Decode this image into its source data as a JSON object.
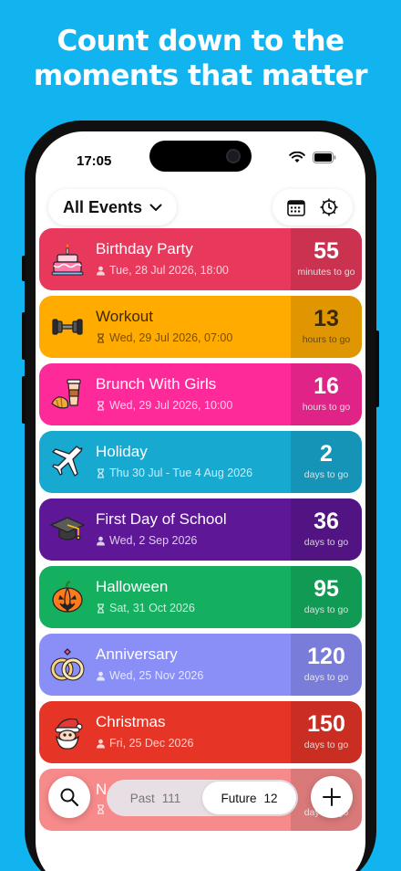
{
  "headline": {
    "line1": "Count down to the",
    "line2": "moments that matter"
  },
  "status_bar": {
    "time": "17:05"
  },
  "topbar": {
    "filter_label": "All Events"
  },
  "events": [
    {
      "title": "Birthday Party",
      "date": "Tue, 28 Jul 2026, 18:00",
      "count": "55",
      "unit": "minutes to go",
      "color": "#e8395c",
      "icon": "cake-icon",
      "person_icon": "person-icon"
    },
    {
      "title": "Workout",
      "date": "Wed, 29 Jul 2026, 07:00",
      "count": "13",
      "unit": "hours to go",
      "color": "#ffab00",
      "icon": "dumbbell-icon",
      "person_icon": "hourglass-icon"
    },
    {
      "title": "Brunch With Girls",
      "date": "Wed, 29 Jul 2026, 10:00",
      "count": "16",
      "unit": "hours to go",
      "color": "#ff2a9a",
      "icon": "coffee-croissant-icon",
      "person_icon": "hourglass-icon"
    },
    {
      "title": "Holiday",
      "date": "Thu 30 Jul - Tue 4 Aug 2026",
      "count": "2",
      "unit": "days to go",
      "color": "#18a9d1",
      "icon": "airplane-icon",
      "person_icon": "hourglass-icon"
    },
    {
      "title": "First Day of School",
      "date": "Wed, 2 Sep 2026",
      "count": "36",
      "unit": "days to go",
      "color": "#5e1796",
      "icon": "graduation-cap-icon",
      "person_icon": "person-icon"
    },
    {
      "title": "Halloween",
      "date": "Sat, 31 Oct 2026",
      "count": "95",
      "unit": "days to go",
      "color": "#14b05f",
      "icon": "pumpkin-icon",
      "person_icon": "hourglass-icon"
    },
    {
      "title": "Anniversary",
      "date": "Wed, 25 Nov 2026",
      "count": "120",
      "unit": "days to go",
      "color": "#8a8ff7",
      "icon": "rings-icon",
      "person_icon": "person-icon"
    },
    {
      "title": "Christmas",
      "date": "Fri, 25 Dec 2026",
      "count": "150",
      "unit": "days to go",
      "color": "#e63426",
      "icon": "santa-icon",
      "person_icon": "person-icon"
    },
    {
      "title": "N",
      "date": "",
      "count": "1",
      "unit": "days to go",
      "color": "#f78a8a",
      "icon": "partial-icon",
      "person_icon": "hourglass-icon"
    }
  ],
  "bottom_bar": {
    "past_label": "Past",
    "past_count": "111",
    "future_label": "Future",
    "future_count": "12"
  }
}
